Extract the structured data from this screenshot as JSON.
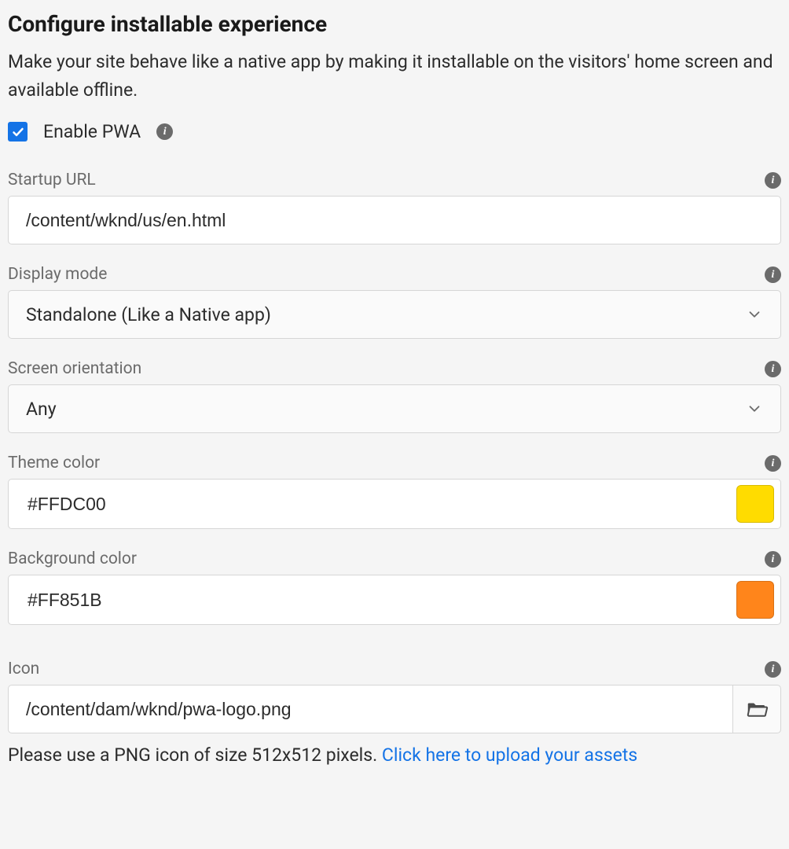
{
  "section": {
    "title": "Configure installable experience",
    "description": "Make your site behave like a native app by making it installable on the visitors' home screen and available offline."
  },
  "enable": {
    "label": "Enable PWA",
    "checked": true
  },
  "fields": {
    "startup_url": {
      "label": "Startup URL",
      "value": "/content/wknd/us/en.html"
    },
    "display_mode": {
      "label": "Display mode",
      "value": "Standalone (Like a Native app)"
    },
    "screen_orientation": {
      "label": "Screen orientation",
      "value": "Any"
    },
    "theme_color": {
      "label": "Theme color",
      "value": "#FFDC00",
      "swatch": "#FFDC00"
    },
    "background_color": {
      "label": "Background color",
      "value": "#FF851B",
      "swatch": "#FF851B"
    },
    "icon": {
      "label": "Icon",
      "value": "/content/dam/wknd/pwa-logo.png",
      "helper_prefix": "Please use a PNG icon of size 512x512 pixels. ",
      "helper_link": "Click here to upload your assets"
    }
  }
}
